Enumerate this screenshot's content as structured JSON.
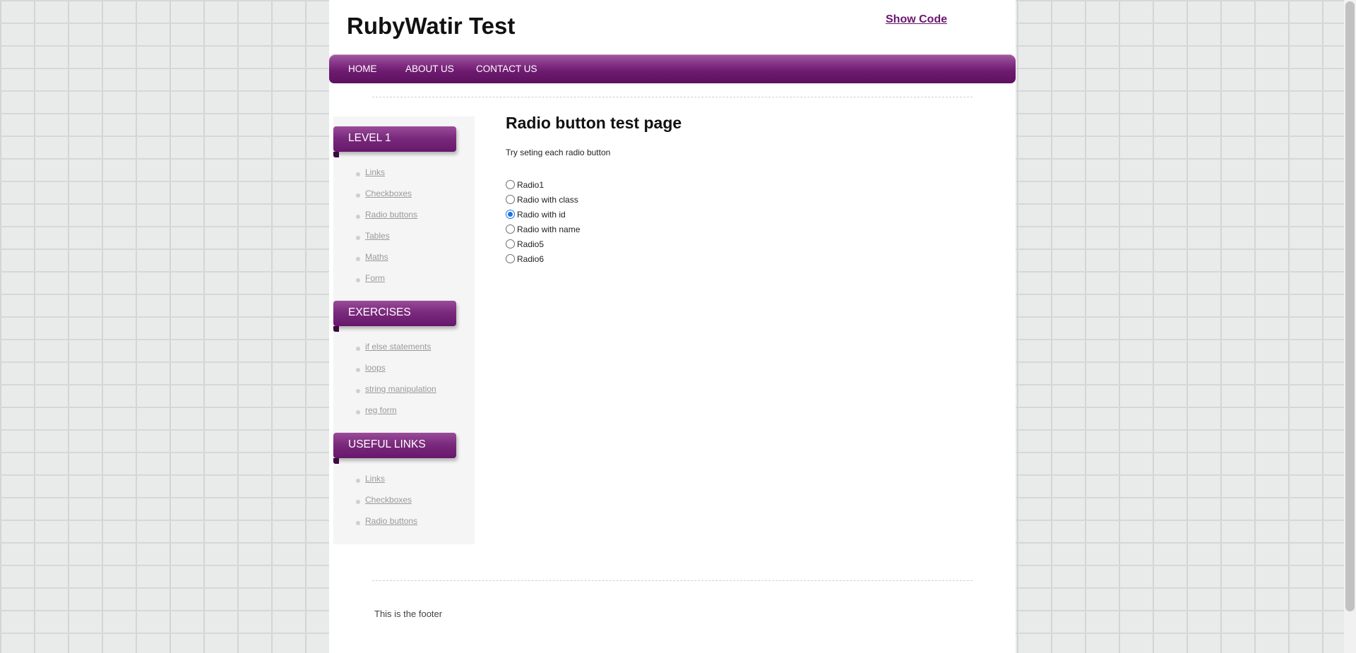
{
  "header": {
    "title": "RubyWatir Test",
    "show_code": "Show Code"
  },
  "nav": {
    "items": [
      "HOME",
      "ABOUT US",
      "CONTACT US"
    ]
  },
  "sidebar": {
    "sections": [
      {
        "heading": "LEVEL 1",
        "links": [
          "Links",
          "Checkboxes",
          "Radio buttons",
          "Tables",
          "Maths",
          "Form"
        ]
      },
      {
        "heading": "EXERCISES",
        "links": [
          "if else statements",
          "loops",
          "string manipulation",
          "reg form"
        ]
      },
      {
        "heading": "USEFUL LINKS",
        "links": [
          "Links",
          "Checkboxes",
          "Radio buttons"
        ]
      }
    ]
  },
  "main": {
    "heading": "Radio button test page",
    "instructions": "Try seting each radio button",
    "radios": [
      {
        "label": "Radio1",
        "checked": false
      },
      {
        "label": "Radio with class",
        "checked": false
      },
      {
        "label": "Radio with id",
        "checked": true
      },
      {
        "label": "Radio with name",
        "checked": false
      },
      {
        "label": "Radio5",
        "checked": false
      },
      {
        "label": "Radio6",
        "checked": false
      }
    ]
  },
  "footer": {
    "text": "This is the footer"
  },
  "colors": {
    "accent": "#6c1b6e",
    "radio_checked": "#1a73e8"
  }
}
